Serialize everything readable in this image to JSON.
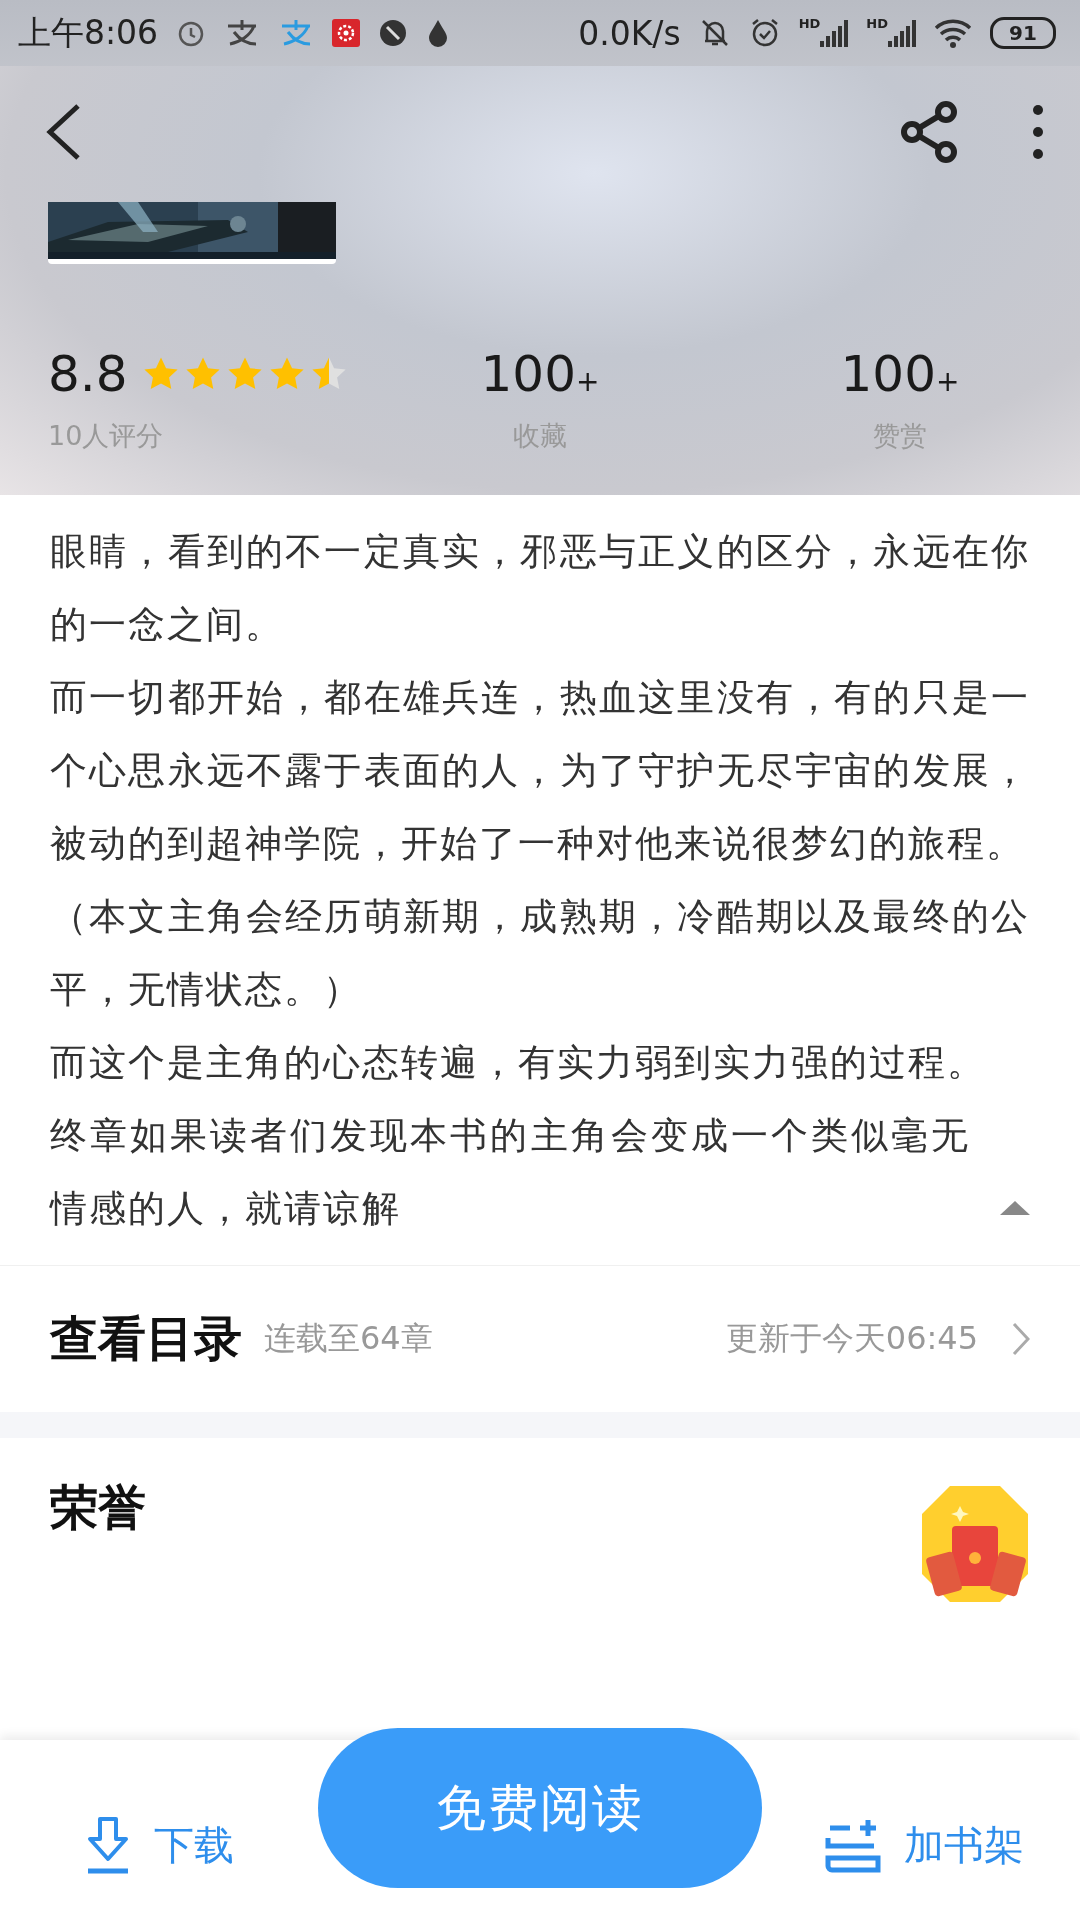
{
  "status_bar": {
    "time": "上午8:06",
    "net_speed": "0.0K/s",
    "signal_labels": [
      "HD",
      "HD"
    ],
    "battery": "91"
  },
  "rating": {
    "score": "8.8",
    "stars": 4.5,
    "caption": "10人评分"
  },
  "stats": [
    {
      "value": "100",
      "suffix": "+",
      "label": "收藏"
    },
    {
      "value": "100",
      "suffix": "+",
      "label": "赞赏"
    }
  ],
  "description": {
    "expanded": true,
    "paragraphs": [
      "眼睛，看到的不一定真实，邪恶与正义的区分，永远在你的一念之间。",
      "而一切都开始，都在雄兵连，热血这里没有，有的只是一个心思永远不露于表面的人，为了守护无尽宇宙的发展，被动的到超神学院，开始了一种对他来说很梦幻的旅程。",
      "（本文主角会经历萌新期，成熟期，冷酷期以及最终的公平，无情状态。）",
      "而这个是主角的心态转遍，有实力弱到实力强的过程。",
      "终章如果读者们发现本书的主角会变成一个类似毫无情感的人，就请谅解"
    ]
  },
  "catalog": {
    "title": "查看目录",
    "progress": "连载至64章",
    "updated": "更新于今天06:45"
  },
  "honor": {
    "title": "荣誉"
  },
  "bottom_bar": {
    "download": "下载",
    "read": "免费阅读",
    "add_shelf": "加书架"
  }
}
